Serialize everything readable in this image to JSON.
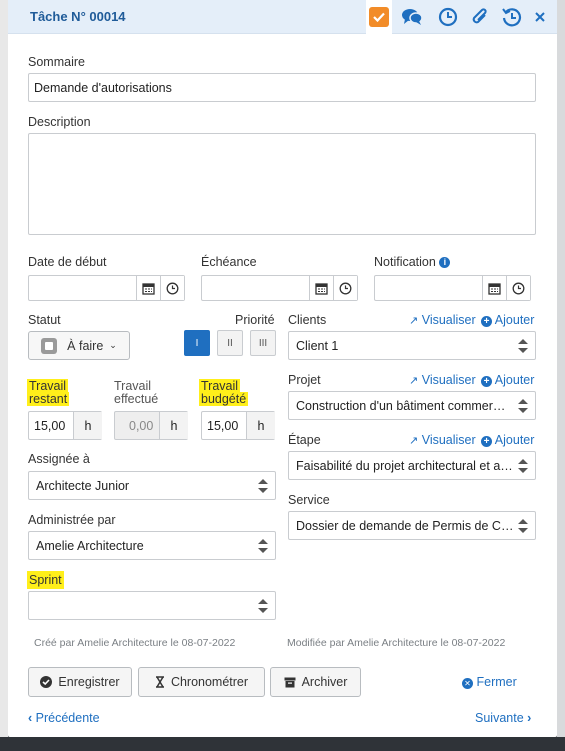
{
  "header": {
    "title": "Tâche N° 00014"
  },
  "fields": {
    "summary_label": "Sommaire",
    "summary_value": "Demande d'autorisations",
    "description_label": "Description",
    "start_date_label": "Date de début",
    "due_label": "Échéance",
    "notification_label": "Notification",
    "status_label": "Statut",
    "status_value": "À faire",
    "priority_label": "Priorité",
    "priority_options": [
      "I",
      "II",
      "III"
    ],
    "remaining_label_1": "Travail",
    "remaining_label_2": "restant",
    "remaining_value": "15,00",
    "done_label_1": "Travail",
    "done_label_2": "effectué",
    "done_value": "0,00",
    "budget_label_1": "Travail",
    "budget_label_2": "budgété",
    "budget_value": "15,00",
    "hours_unit": "h",
    "assigned_label": "Assignée à",
    "assigned_value": "Architecte Junior",
    "admin_label": "Administrée par",
    "admin_value": "Amelie Architecture",
    "sprint_label": "Sprint",
    "sprint_value": "",
    "clients_label": "Clients",
    "clients_value": "Client 1",
    "project_label": "Projet",
    "project_value": "Construction d'un bâtiment commer…",
    "stage_label": "Étape",
    "stage_value": "Faisabilité du projet architectural et a…",
    "service_label": "Service",
    "service_value": "Dossier de demande de Permis de C…",
    "view_link": "Visualiser",
    "add_link": "Ajouter"
  },
  "meta": {
    "created": "Créé par Amelie Architecture le 08-07-2022",
    "modified": "Modifiée par Amelie Architecture le 08-07-2022"
  },
  "buttons": {
    "save": "Enregistrer",
    "timer": "Chronométrer",
    "archive": "Archiver",
    "close": "Fermer",
    "previous": "Précédente",
    "next": "Suivante"
  },
  "colors": {
    "accent": "#1f6fc0",
    "highlight": "#ffef1a",
    "check": "#f28c28"
  }
}
